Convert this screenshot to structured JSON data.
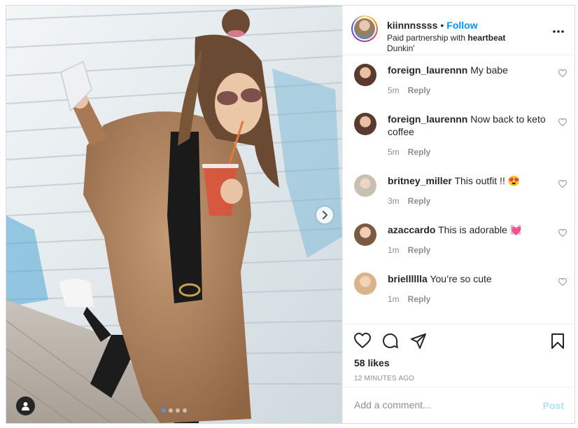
{
  "post": {
    "header": {
      "username": "kiinnnssss",
      "bullet": "•",
      "follow_label": "Follow",
      "partnership_prefix": "Paid partnership with",
      "partner": "heartbeat",
      "location": "Dunkin'",
      "more_icon": "more-horizontal-icon"
    },
    "carousel": {
      "slide_count": 4,
      "active_index": 0,
      "next_icon": "chevron-right-icon",
      "user_tag_icon": "user-icon",
      "active_dot_color": "#3d9df2"
    },
    "comments": [
      {
        "user": "foreign_laurennn",
        "text": "My babe",
        "age": "5m",
        "reply_label": "Reply"
      },
      {
        "user": "foreign_laurennn",
        "text": "Now back to keto coffee",
        "age": "5m",
        "reply_label": "Reply"
      },
      {
        "user": "britney_miller",
        "text": "This outfit !! 😍",
        "age": "3m",
        "reply_label": "Reply"
      },
      {
        "user": "azaccardo",
        "text": "This is adorable 💓",
        "age": "1m",
        "reply_label": "Reply"
      },
      {
        "user": "brielllllla",
        "text": "You’re so cute",
        "age": "1m",
        "reply_label": "Reply"
      }
    ],
    "actions": {
      "like_icon": "heart-icon",
      "comment_icon": "comment-icon",
      "share_icon": "paper-plane-icon",
      "save_icon": "bookmark-icon"
    },
    "likes": "58 likes",
    "timestamp": "12 MINUTES AGO",
    "add_comment": {
      "placeholder": "Add a comment...",
      "post_label": "Post"
    },
    "colors": {
      "link_blue": "#0095f6",
      "post_disabled": "#b2dffc",
      "meta_gray": "#8e8e8e"
    }
  }
}
